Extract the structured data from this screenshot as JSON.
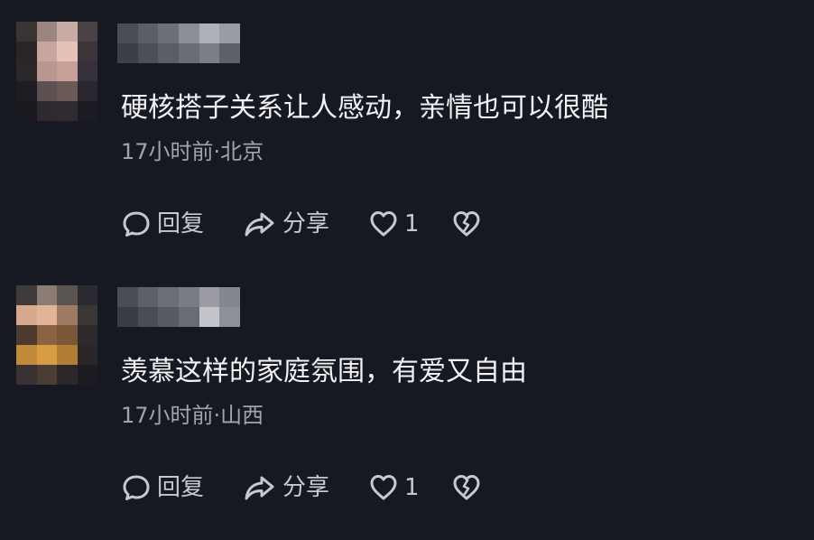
{
  "comments": [
    {
      "text": "硬核搭子关系让人感动，亲情也可以很酷",
      "meta": "17小时前·北京",
      "actions": {
        "reply": "回复",
        "share": "分享",
        "likes": "1"
      },
      "avatar_pixels": [
        "#3a3434",
        "#9a8580",
        "#c9aca6",
        "#4a4244",
        "#2a2527",
        "#caa59e",
        "#e6c1b8",
        "#3c3538",
        "#2b2628",
        "#b8978e",
        "#c69f97",
        "#35303a",
        "#1f1d24",
        "#5e5052",
        "#6b5a58",
        "#2a2730",
        "#1b1a20",
        "#2e2a2f",
        "#302b31",
        "#1c1b22"
      ],
      "username_pixels": [
        "#4a4c56",
        "#5c5e68",
        "#6e7079",
        "#8c8d95",
        "#aeb0b7",
        "#9a9ba3",
        "#3d3f48",
        "#4d4f58",
        "#5a5c66",
        "#6b6d76",
        "#7c7e87",
        "#5e6069"
      ]
    },
    {
      "text": "羡慕这样的家庭氛围，有爱又自由",
      "meta": "17小时前·山西",
      "actions": {
        "reply": "回复",
        "share": "分享",
        "likes": "1"
      },
      "avatar_pixels": [
        "#3e3a3c",
        "#8c7b72",
        "#5a5450",
        "#2b2a30",
        "#d6a88c",
        "#e2b394",
        "#9c7a64",
        "#3b3636",
        "#4c3a2e",
        "#8a6440",
        "#7a5836",
        "#2e2a2c",
        "#c08a3a",
        "#d89c44",
        "#b07e34",
        "#2a2628",
        "#3a3232",
        "#4a3e34",
        "#2c2829",
        "#1d1c22"
      ],
      "username_pixels": [
        "#4a4c56",
        "#5e6069",
        "#6c6e77",
        "#7a7c85",
        "#9a9ba3",
        "#858790",
        "#3b3d46",
        "#4b4d56",
        "#585a63",
        "#6a6c75",
        "#c4c5cb",
        "#8e9098"
      ]
    }
  ]
}
